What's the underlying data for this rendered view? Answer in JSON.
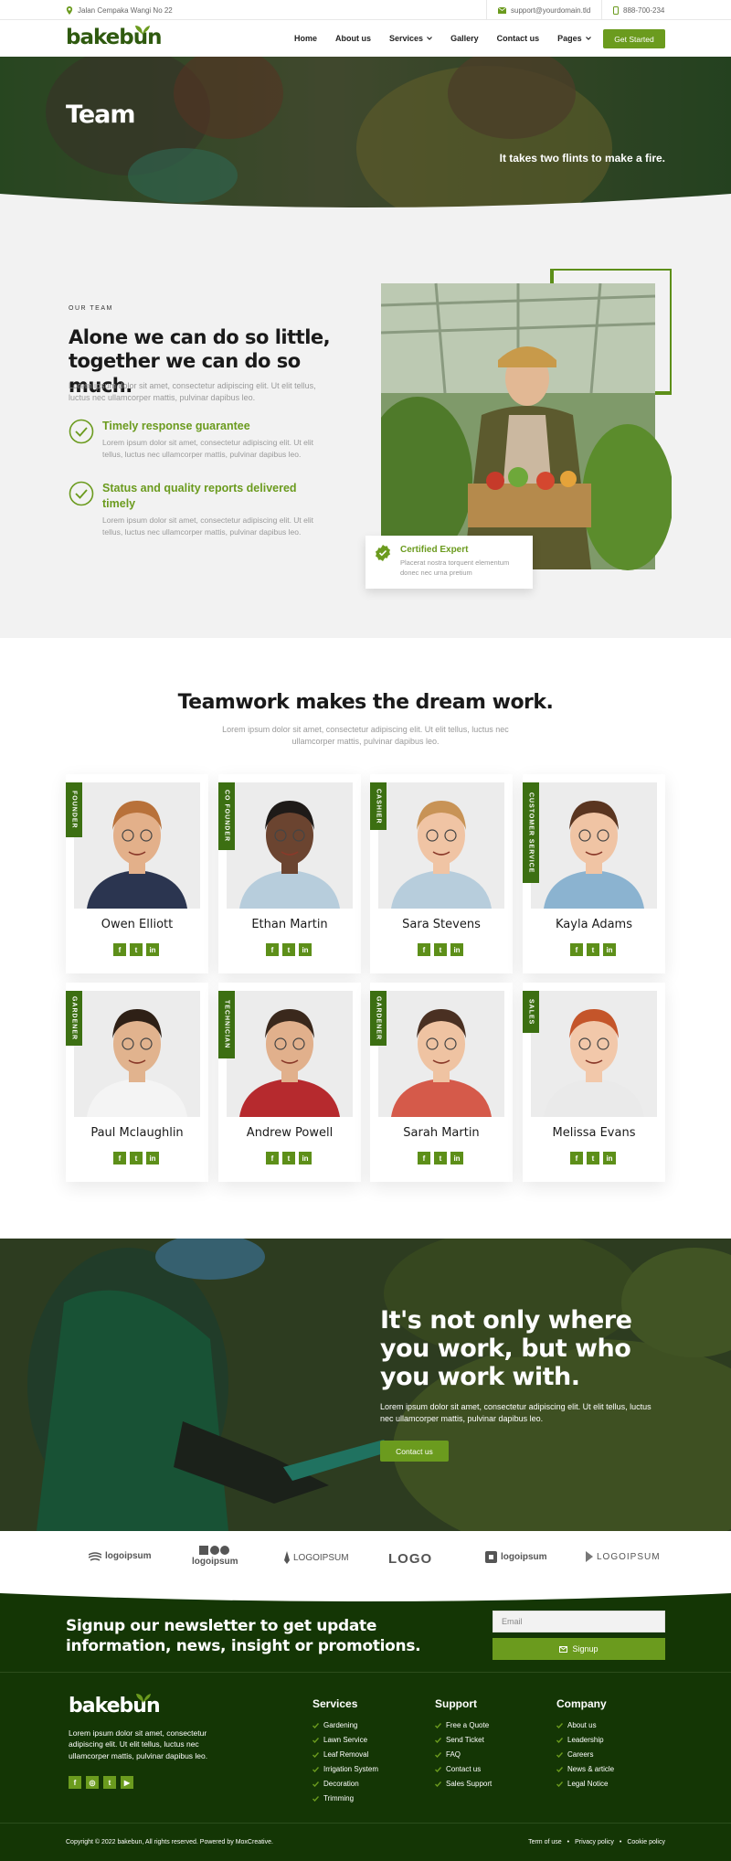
{
  "topbar": {
    "address": "Jalan Cempaka Wangi No 22",
    "email": "support@yourdomain.tld",
    "phone": "888-700-234"
  },
  "nav": {
    "logo": "bakebun",
    "items": [
      {
        "label": "Home"
      },
      {
        "label": "About us"
      },
      {
        "label": "Services",
        "caret": true
      },
      {
        "label": "Gallery"
      },
      {
        "label": "Contact us"
      },
      {
        "label": "Pages",
        "caret": true
      }
    ],
    "cta": "Get Started"
  },
  "hero": {
    "title": "Team",
    "tagline": "It takes two flints to make a fire."
  },
  "about": {
    "label": "OUR TEAM",
    "title": "Alone we can do so little, together we can do so much.",
    "lead": "Lorem ipsum dolor sit amet, consectetur adipiscing elit. Ut elit tellus, luctus nec ullamcorper mattis, pulvinar dapibus leo.",
    "features": [
      {
        "title": "Timely response guarantee",
        "text": "Lorem ipsum dolor sit amet, consectetur adipiscing elit. Ut elit tellus, luctus nec ullamcorper mattis, pulvinar dapibus leo."
      },
      {
        "title": "Status and quality reports delivered timely",
        "text": "Lorem ipsum dolor sit amet, consectetur adipiscing elit. Ut elit tellus, luctus nec ullamcorper mattis, pulvinar dapibus leo."
      }
    ],
    "cert_title": "Certified Expert",
    "cert_text": "Placerat nostra torquent elementum donec nec urna pretium"
  },
  "team": {
    "title": "Teamwork makes the dream work.",
    "subtitle": "Lorem ipsum dolor sit amet, consectetur adipiscing elit. Ut elit tellus, luctus nec ullamcorper mattis, pulvinar dapibus leo.",
    "members": [
      {
        "name": "Owen Elliott",
        "role": "FOUNDER"
      },
      {
        "name": "Ethan Martin",
        "role": "CO FOUNDER"
      },
      {
        "name": "Sara Stevens",
        "role": "CASHIER"
      },
      {
        "name": "Kayla Adams",
        "role": "CUSTOMER SERVICE"
      },
      {
        "name": "Paul Mclaughlin",
        "role": "GARDENER"
      },
      {
        "name": "Andrew Powell",
        "role": "TECHNICIAN"
      },
      {
        "name": "Sarah Martin",
        "role": "GARDENER"
      },
      {
        "name": "Melissa Evans",
        "role": "SALES"
      }
    ],
    "social": [
      "f",
      "t",
      "in"
    ]
  },
  "banner": {
    "title": "It's not only where you work, but who you work with.",
    "text": "Lorem ipsum dolor sit amet, consectetur adipiscing elit. Ut elit tellus, luctus nec ullamcorper mattis, pulvinar dapibus leo.",
    "cta": "Contact us"
  },
  "logos": [
    "logoipsum",
    "logoipsum",
    "LOGOIPSUM",
    "LOGO",
    "logoipsum",
    "LOGOIPSUM"
  ],
  "footer": {
    "newsletter": "Signup our newsletter to get update information, news, insight or promotions.",
    "email_placeholder": "Email",
    "signup": "Signup",
    "logo": "bakebun",
    "desc": "Lorem ipsum dolor sit amet, consectetur adipiscing elit. Ut elit tellus, luctus nec ullamcorper mattis, pulvinar dapibus leo.",
    "columns": [
      {
        "title": "Services",
        "items": [
          "Gardening",
          "Lawn Service",
          "Leaf Removal",
          "Irrigation System",
          "Decoration",
          "Trimming"
        ]
      },
      {
        "title": "Support",
        "items": [
          "Free a Quote",
          "Send Ticket",
          "FAQ",
          "Contact us",
          "Sales Support"
        ]
      },
      {
        "title": "Company",
        "items": [
          "About us",
          "Leadership",
          "Careers",
          "News & article",
          "Legal Notice"
        ]
      }
    ],
    "copyright": "Copyright © 2022 bakebun, All rights reserved. Powered by MoxCreative.",
    "legal": [
      "Term of use",
      "Privacy policy",
      "Cookie policy"
    ]
  },
  "colors": {
    "accent": "#6b9b1e",
    "footer": "#143605",
    "role_tag": "#3c6f12"
  }
}
